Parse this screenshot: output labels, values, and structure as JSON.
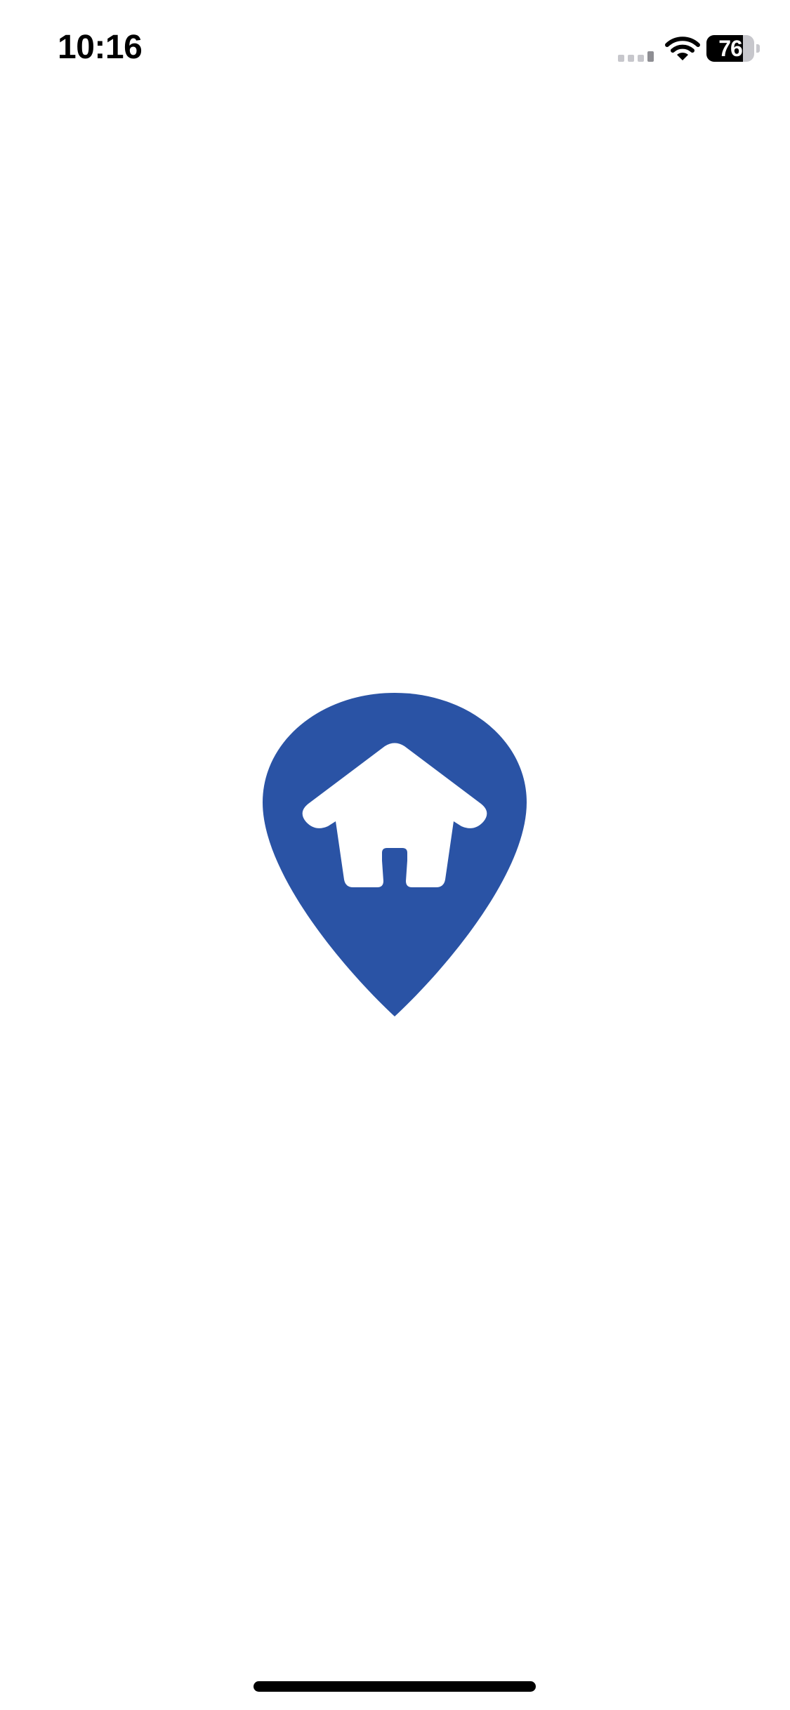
{
  "status_bar": {
    "time": "10:16",
    "signal_icon": "cellular-signal-icon",
    "wifi_icon": "wifi-icon",
    "battery_level": "76",
    "battery_fraction": 0.76
  },
  "splash": {
    "logo_icon": "home-location-pin-icon",
    "brand_color": "#2a53a5",
    "glyph_color": "#ffffff"
  },
  "home_indicator": {
    "color": "#000000"
  }
}
